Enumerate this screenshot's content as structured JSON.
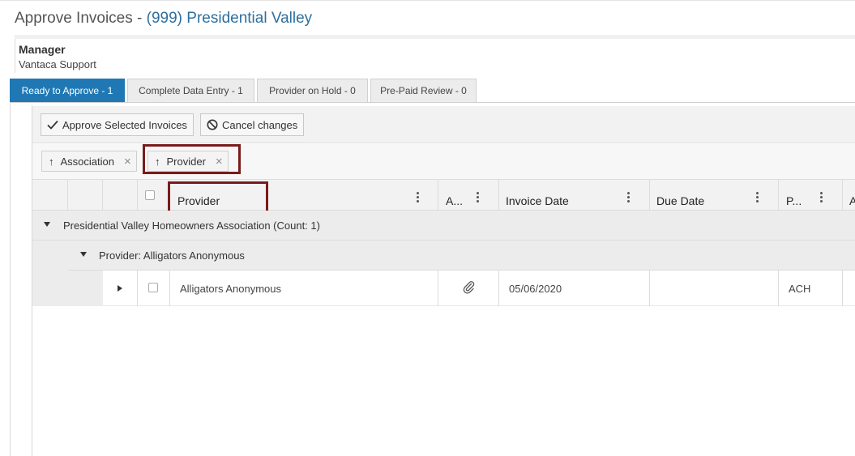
{
  "header": {
    "title_prefix": "Approve Invoices - ",
    "association": "(999) Presidential Valley",
    "role_label": "Manager",
    "role_name": "Vantaca Support"
  },
  "tabs": [
    {
      "label": "Ready to Approve - 1",
      "active": true
    },
    {
      "label": "Complete Data Entry - 1",
      "active": false
    },
    {
      "label": "Provider on Hold - 0",
      "active": false
    },
    {
      "label": "Pre-Paid Review - 0",
      "active": false
    }
  ],
  "toolbar": {
    "approve_label": "Approve Selected Invoices",
    "cancel_label": "Cancel changes"
  },
  "grouping": {
    "chips": [
      {
        "label": "Association",
        "icon": "sort-ascending-icon"
      },
      {
        "label": "Provider",
        "icon": "sort-ascending-icon"
      }
    ]
  },
  "grid": {
    "columns": [
      "Provider",
      "A...",
      "Invoice Date",
      "Due Date",
      "P...",
      "A"
    ],
    "group_level1": "Presidential Valley Homeowners Association (Count: 1)",
    "group_level2": "Provider: Alligators Anonymous",
    "rows": [
      {
        "provider": "Alligators Anonymous",
        "attachment_icon": "paperclip-icon",
        "invoice_date": "05/06/2020",
        "due_date": "",
        "payment": "ACH"
      }
    ]
  },
  "colors": {
    "accent": "#1f78b4",
    "link": "#2e6f9e",
    "highlight": "#7a1b1b"
  }
}
